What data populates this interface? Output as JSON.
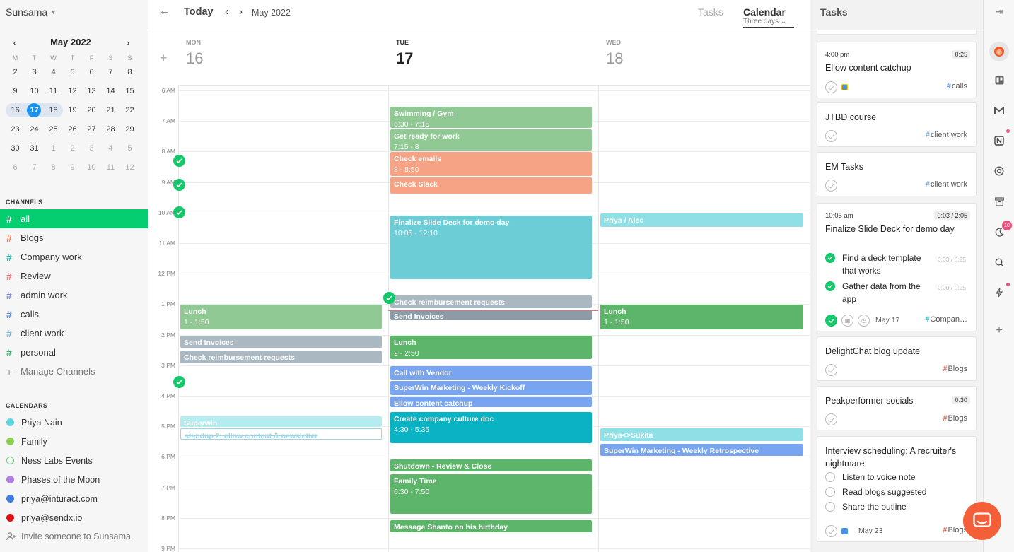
{
  "sidebar": {
    "workspace": "Sunsama",
    "mini_cal": {
      "title": "May 2022",
      "dow": [
        "M",
        "T",
        "W",
        "T",
        "F",
        "S",
        "S"
      ],
      "weeks": [
        [
          "2",
          "3",
          "4",
          "5",
          "6",
          "7",
          "8"
        ],
        [
          "9",
          "10",
          "11",
          "12",
          "13",
          "14",
          "15"
        ],
        [
          "16",
          "17",
          "18",
          "19",
          "20",
          "21",
          "22"
        ],
        [
          "23",
          "24",
          "25",
          "26",
          "27",
          "28",
          "29"
        ],
        [
          "30",
          "31",
          "1",
          "2",
          "3",
          "4",
          "5"
        ],
        [
          "6",
          "7",
          "8",
          "9",
          "10",
          "11",
          "12"
        ]
      ]
    },
    "channels_label": "CHANNELS",
    "channels": [
      {
        "name": "all",
        "color": "#ffffff"
      },
      {
        "name": "Blogs",
        "color": "#f0735a"
      },
      {
        "name": "Company work",
        "color": "#1fb6b3"
      },
      {
        "name": "Review",
        "color": "#f06e7a"
      },
      {
        "name": "admin work",
        "color": "#7e85d8"
      },
      {
        "name": "calls",
        "color": "#5b8de0"
      },
      {
        "name": "client work",
        "color": "#7fb2d8"
      },
      {
        "name": "personal",
        "color": "#3cb371"
      }
    ],
    "manage_channels": "Manage Channels",
    "calendars_label": "CALENDARS",
    "calendars": [
      {
        "name": "Priya Nain",
        "color": "#5fd6e0"
      },
      {
        "name": "Family",
        "color": "#8cd152"
      },
      {
        "name": "Ness Labs Events",
        "color": "#5bd16e"
      },
      {
        "name": "Phases of the Moon",
        "color": "#b17fe3"
      },
      {
        "name": "priya@inturact.com",
        "color": "#3d7fe0"
      },
      {
        "name": "priya@sendx.io",
        "color": "#e01010"
      }
    ],
    "invite": "Invite someone to Sunsama"
  },
  "topbar": {
    "today": "Today",
    "month": "May 2022",
    "tab_tasks": "Tasks",
    "tab_calendar": "Calendar",
    "view": "Three days"
  },
  "days": [
    {
      "dow": "MON",
      "num": "16"
    },
    {
      "dow": "TUE",
      "num": "17"
    },
    {
      "dow": "WED",
      "num": "18"
    }
  ],
  "hours": [
    "6 AM",
    "7 AM",
    "8 AM",
    "9 AM",
    "10 AM",
    "11 AM",
    "12 PM",
    "1 PM",
    "2 PM",
    "3 PM",
    "4 PM",
    "5 PM",
    "6 PM",
    "7 PM",
    "8 PM",
    "9 PM"
  ],
  "events": [
    {
      "day": 1,
      "start": 6.5,
      "end": 7.25,
      "title": "Swimming / Gym",
      "time": "6:30 - 7:15",
      "color": "#91c995"
    },
    {
      "day": 1,
      "start": 7.25,
      "end": 8.0,
      "title": "Get ready for work",
      "time": "7:15 - 8",
      "color": "#91c995"
    },
    {
      "day": 1,
      "start": 8.0,
      "end": 8.83,
      "title": "Check emails",
      "time": "8 - 8:50",
      "color": "#f5a285"
    },
    {
      "day": 1,
      "start": 8.83,
      "end": 9.4,
      "title": "Check Slack",
      "time": "",
      "color": "#f5a285"
    },
    {
      "day": 1,
      "start": 10.08,
      "end": 12.2,
      "title": "Finalize Slide Deck for demo day",
      "time": "10:05 - 12:10",
      "color": "#6ccdd6"
    },
    {
      "day": 1,
      "start": 12.7,
      "end": 13.15,
      "title": "Check reimbursement requests",
      "time": "",
      "color": "#aab8c2"
    },
    {
      "day": 1,
      "start": 13.15,
      "end": 13.5,
      "title": "Send Invoices",
      "time": "",
      "color": "#8c9ba6"
    },
    {
      "day": 1,
      "start": 14.0,
      "end": 14.83,
      "title": "Lunch",
      "time": "2 - 2:50",
      "color": "#5db56a"
    },
    {
      "day": 1,
      "start": 15.0,
      "end": 15.5,
      "title": "Call with Vendor",
      "time": "",
      "color": "#78a4f0"
    },
    {
      "day": 1,
      "start": 15.5,
      "end": 16.0,
      "title": "SuperWin Marketing - Weekly Kickoff",
      "time": "",
      "color": "#78a4f0"
    },
    {
      "day": 1,
      "start": 16.0,
      "end": 16.35,
      "title": "Ellow content catchup",
      "time": "",
      "color": "#78a4f0"
    },
    {
      "day": 1,
      "start": 16.5,
      "end": 17.58,
      "title": "Create company culture doc",
      "time": "4:30 - 5:35",
      "color": "#0ab3c3"
    },
    {
      "day": 1,
      "start": 18.05,
      "end": 18.5,
      "title": "Shutdown - Review & Close",
      "time": "",
      "color": "#5db56a"
    },
    {
      "day": 1,
      "start": 18.55,
      "end": 19.9,
      "title": "Family Time",
      "time": "6:30 - 7:50",
      "color": "#5db56a"
    },
    {
      "day": 1,
      "start": 20.05,
      "end": 20.5,
      "title": "Message Shanto on his birthday",
      "time": "",
      "color": "#5db56a"
    },
    {
      "day": 0,
      "start": 13.0,
      "end": 13.85,
      "title": "Lunch",
      "time": "1 - 1:50",
      "color": "#91c995"
    },
    {
      "day": 0,
      "start": 14.0,
      "end": 14.45,
      "title": "Send Invoices",
      "time": "",
      "color": "#aab8c2"
    },
    {
      "day": 0,
      "start": 14.5,
      "end": 14.95,
      "title": "Check reimbursement requests",
      "time": "",
      "color": "#aab8c2"
    },
    {
      "day": 0,
      "start": 16.65,
      "end": 17.05,
      "title": "Superwin",
      "time": "",
      "color": "#b5ecf0"
    },
    {
      "day": 0,
      "start": 17.05,
      "end": 17.45,
      "title": "standup 2: ellow content & newsletter",
      "time": "",
      "color": "#ffffff",
      "outline": true
    },
    {
      "day": 2,
      "start": 10.0,
      "end": 10.5,
      "title": "Priya / Alec",
      "time": "",
      "color": "#8fe0e6"
    },
    {
      "day": 2,
      "start": 13.0,
      "end": 13.85,
      "title": "Lunch",
      "time": "1 - 1:50",
      "color": "#5db56a"
    },
    {
      "day": 2,
      "start": 17.05,
      "end": 17.5,
      "title": "Priya<>Sukita",
      "time": "",
      "color": "#8fe0e6"
    },
    {
      "day": 2,
      "start": 17.55,
      "end": 18.0,
      "title": "SuperWin Marketing - Weekly Retrospective",
      "time": "",
      "color": "#78a4f0"
    }
  ],
  "now_hour": 13.2,
  "panel": {
    "title": "Tasks",
    "cards": [
      {
        "time": "4:00 pm",
        "dur": "0:25",
        "title": "Ellow content catchup",
        "tag": "calls",
        "tag_color": "#5b8de0"
      },
      {
        "title": "JTBD course",
        "tag": "client work",
        "tag_color": "#7fb2d8"
      },
      {
        "title": "EM Tasks",
        "tag": "client work",
        "tag_color": "#7fb2d8"
      },
      {
        "time": "10:05 am",
        "dur": "0:03 / 2:05",
        "title": "Finalize Slide Deck for demo day",
        "date": "May 17",
        "tag": "Compan…",
        "tag_color": "#1fb6b3",
        "subs": [
          {
            "label": "Find a deck template that works",
            "mini": "0:03 / 0:25"
          },
          {
            "label": "Gather data from the app",
            "mini": "0:00 / 0:25"
          }
        ]
      },
      {
        "title": "DelightChat blog update",
        "tag": "Blogs",
        "tag_color": "#f0735a"
      },
      {
        "dur": "0:30",
        "title": "Peakperformer socials",
        "tag": "Blogs",
        "tag_color": "#f0735a"
      },
      {
        "title": "Interview scheduling: A recruiter's nightmare",
        "date": "May 23",
        "tag": "Blogs",
        "tag_color": "#f0735a",
        "subs": [
          {
            "label": "Listen to voice note"
          },
          {
            "label": "Read blogs suggested"
          },
          {
            "label": "Share the outline"
          }
        ]
      }
    ]
  },
  "rail": {
    "notif_count": "10"
  }
}
